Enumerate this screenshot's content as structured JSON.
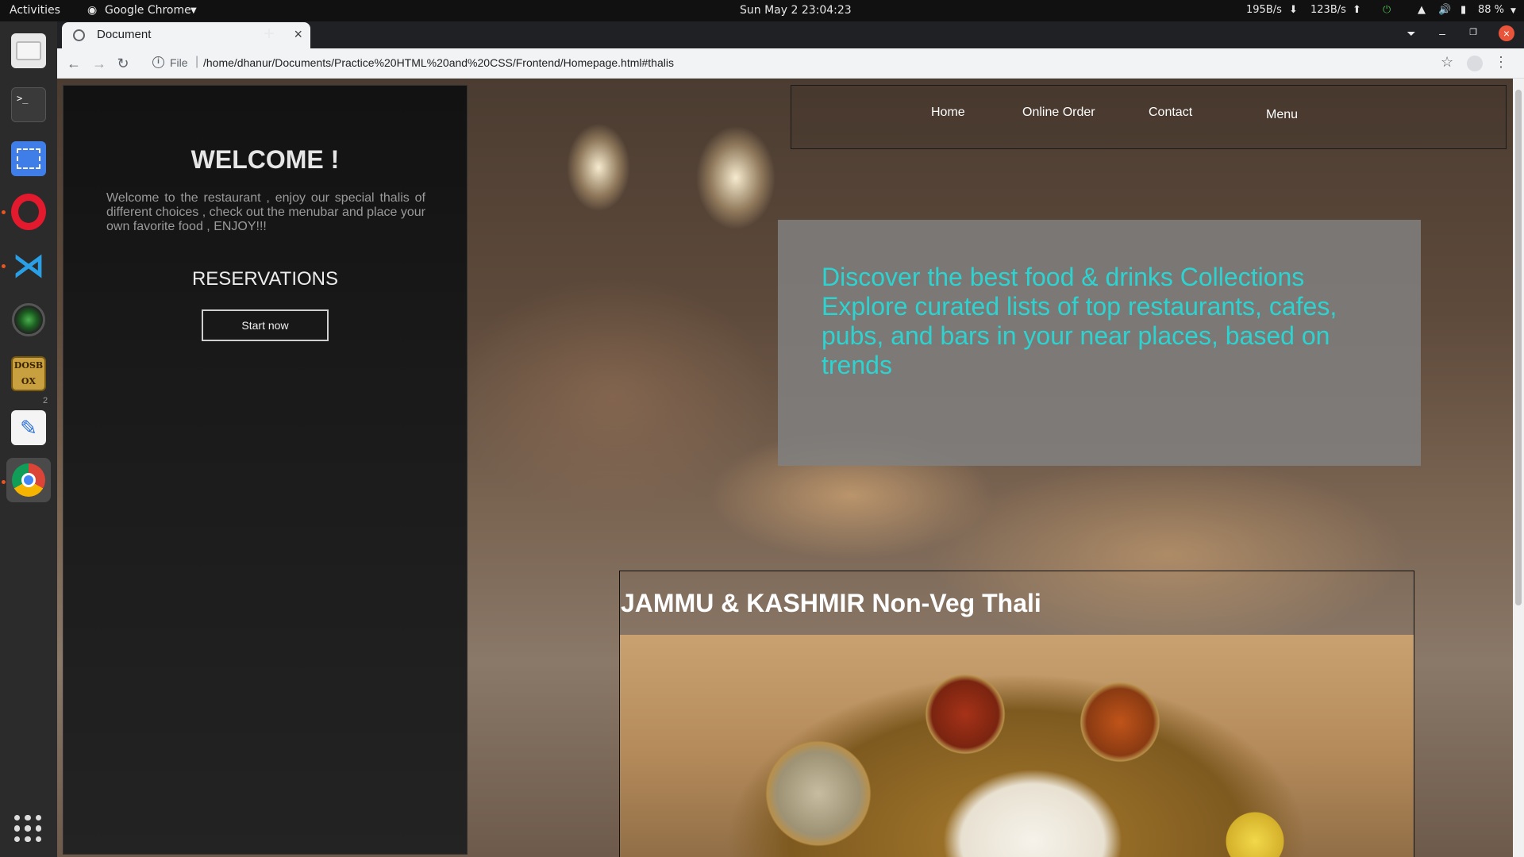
{
  "system_bar": {
    "activities": "Activities",
    "app_menu": "Google Chrome",
    "clock": "Sun May 2  23:04:23",
    "net_down": "195B/s",
    "net_up": "123B/s",
    "battery": "88 %"
  },
  "dock": {
    "apps": [
      {
        "name": "Files",
        "icon": "files-icon",
        "running": false
      },
      {
        "name": "Terminal",
        "icon": "terminal-icon",
        "running": false
      },
      {
        "name": "Screenshot",
        "icon": "screenshot-icon",
        "running": false
      },
      {
        "name": "Opera",
        "icon": "opera-icon",
        "running": true
      },
      {
        "name": "Visual Studio Code",
        "icon": "vscode-icon",
        "running": true
      },
      {
        "name": "Camera",
        "icon": "camera-icon",
        "running": false
      },
      {
        "name": "DOSBox",
        "icon": "dosbox-icon",
        "running": false
      },
      {
        "name": "Text Editor",
        "icon": "text-editor-icon",
        "running": false
      },
      {
        "name": "Google Chrome",
        "icon": "chrome-icon",
        "running": true
      }
    ],
    "dosbox_letters": [
      "D",
      "O",
      "S",
      "B",
      "O",
      "X"
    ],
    "badge": "2"
  },
  "browser": {
    "tab_title": "Document",
    "scheme": "File",
    "url": "/home/dhanur/Documents/Practice%20HTML%20and%20CSS/Frontend/Homepage.html#thalis"
  },
  "page": {
    "welcome_title": "WELCOME !",
    "welcome_text": "Welcome to the restaurant , enjoy our special thalis of different choices , check out the menubar and place your own favorite food , ENJOY!!!",
    "reservations_title": "RESERVATIONS",
    "start_button": "Start now",
    "nav": {
      "home": "Home",
      "online_order": "Online Order",
      "contact": "Contact",
      "menu": "Menu"
    },
    "hero_text": "Discover the best food & drinks Collections Explore curated lists of top restaurants, cafes, pubs, and bars in your near places, based on trends",
    "thali_title": "JAMMU & KASHMIR Non-Veg Thali"
  },
  "colors": {
    "hero_text": "#2ed3d0",
    "hero_bg": "#808080",
    "side_panel_bg": "#151515",
    "running_dot": "#e95420"
  }
}
